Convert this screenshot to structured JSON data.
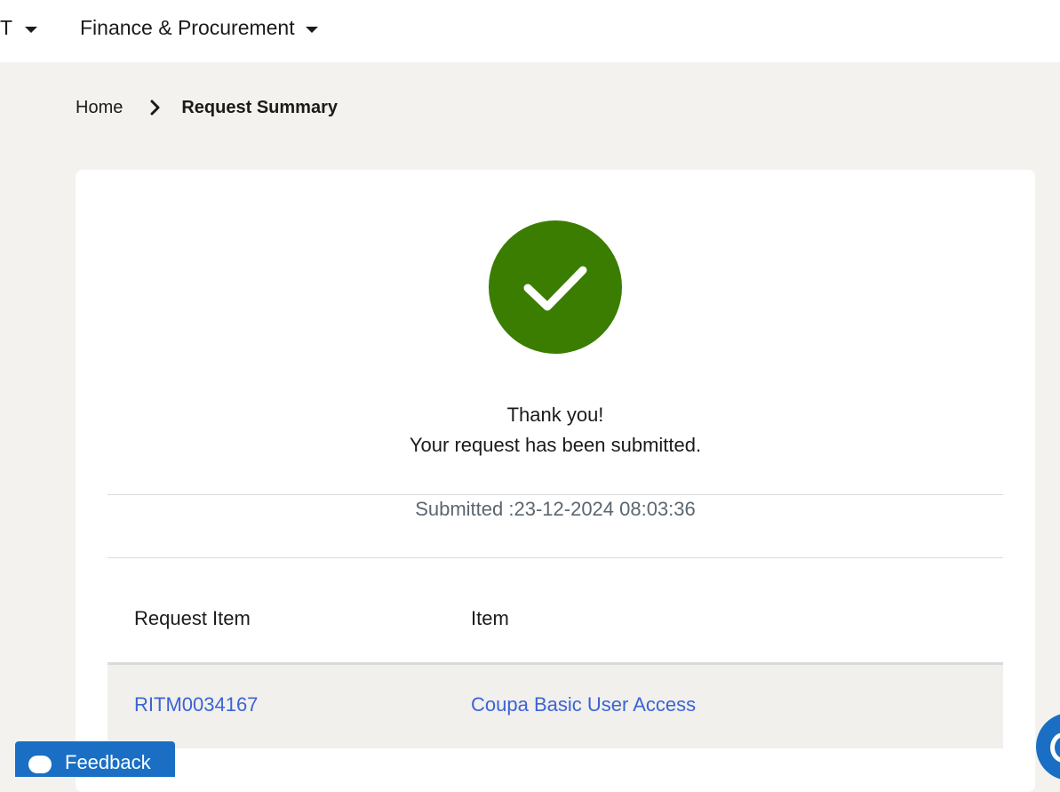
{
  "nav": {
    "items": [
      {
        "label": "T"
      },
      {
        "label": "Finance & Procurement"
      }
    ]
  },
  "breadcrumb": {
    "home": "Home",
    "current": "Request Summary"
  },
  "summary": {
    "thanks": "Thank you!",
    "message": "Your request has been submitted.",
    "submitted_label": "Submitted :",
    "submitted_value": "23-12-2024 08:03:36",
    "success_color": "#3a7d00"
  },
  "table": {
    "headers": [
      "Request Item",
      "Item"
    ],
    "rows": [
      [
        "RITM0034167",
        "Coupa Basic User Access"
      ]
    ]
  },
  "feedback": {
    "label": "Feedback"
  },
  "colors": {
    "link": "#3c63d6",
    "brand_blue": "#1a6fc4",
    "page_bg": "#f3f2ee"
  }
}
